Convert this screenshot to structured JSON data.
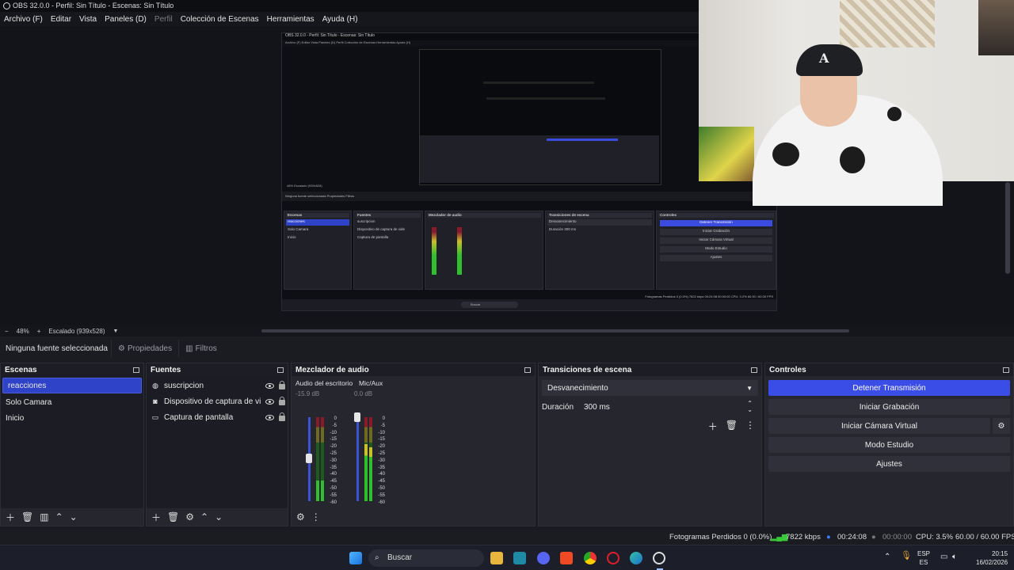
{
  "window": {
    "title": "OBS 32.0.0 - Perfil: Sin Título - Escenas: Sin Título"
  },
  "menu": [
    {
      "label": "Archivo (F)",
      "enabled": true
    },
    {
      "label": "Editar",
      "enabled": true
    },
    {
      "label": "Vista",
      "enabled": true
    },
    {
      "label": "Paneles (D)",
      "enabled": true
    },
    {
      "label": "Perfil",
      "enabled": false
    },
    {
      "label": "Colección de Escenas",
      "enabled": true
    },
    {
      "label": "Herramientas",
      "enabled": true
    },
    {
      "label": "Ayuda (H)",
      "enabled": true
    }
  ],
  "preview": {
    "zoom_minus": "−",
    "zoom": "48%",
    "zoom_plus": "+",
    "scale_mode": "Escalado (939x528)",
    "nested": {
      "title": "OBS 32.0.0 - Perfil: Sin Título - Escenas: Sin Título",
      "menu": "Archivo (F)   Editar   Vista   Paneles (D)   Perfil   Colección de Escenas   Herramientas   Ayuda (H)",
      "toolbar": "Ninguna fuente seleccionada     Propiedades     Filtros",
      "zoom_line": "48%    Escalado (939x528)",
      "scenes_title": "Escenas",
      "scenes": [
        "reacciones",
        "Solo Camara",
        "Inicio"
      ],
      "sources_title": "Fuentes",
      "sources": [
        "suscripcion",
        "Dispositivo de captura de vide",
        "Captura de pantalla"
      ],
      "mixer_title": "Mezclador de audio",
      "transitions_title": "Transiciones de escena",
      "transition": "Desvanecimiento",
      "duration": "Duración   300 ms",
      "controls_title": "Controles",
      "controls": [
        "Detener Transmisión",
        "Iniciar Grabación",
        "Iniciar Cámara Virtual",
        "Modo Estudio",
        "Ajustes"
      ],
      "status": "Fotogramas Perdidos 0 (0.0%)   7822 kbps   00:24:08   00:00:00   CPU: 3.2%   60.00 / 60.00 FPS",
      "search": "Buscar"
    }
  },
  "context_bar": {
    "no_selection": "Ninguna fuente seleccionada",
    "properties": "Propiedades",
    "filters": "Filtros"
  },
  "scenes": {
    "title": "Escenas",
    "items": [
      {
        "label": "reacciones",
        "selected": true
      },
      {
        "label": "Solo Camara",
        "selected": false
      },
      {
        "label": "Inicio",
        "selected": false
      }
    ]
  },
  "sources": {
    "title": "Fuentes",
    "items": [
      {
        "label": "suscripcion",
        "icon": "globe-icon"
      },
      {
        "label": "Dispositivo de captura de video",
        "icon": "camera-icon"
      },
      {
        "label": "Captura de pantalla",
        "icon": "monitor-icon"
      }
    ]
  },
  "mixer": {
    "title": "Mezclador de audio",
    "channels": [
      {
        "name": "Audio del escritorio",
        "db": "-15.9 dB"
      },
      {
        "name": "Mic/Aux",
        "db": "0.0 dB"
      }
    ],
    "scale": [
      "0",
      "-5",
      "-10",
      "-15",
      "-20",
      "-25",
      "-30",
      "-35",
      "-40",
      "-45",
      "-50",
      "-55",
      "-60"
    ]
  },
  "transitions": {
    "title": "Transiciones de escena",
    "selected": "Desvanecimiento",
    "duration_label": "Duración",
    "duration_value": "300 ms"
  },
  "controls": {
    "title": "Controles",
    "stop_stream": "Detener Transmisión",
    "start_recording": "Iniciar Grabación",
    "start_virtual_cam": "Iniciar Cámara Virtual",
    "studio_mode": "Modo Estudio",
    "settings": "Ajustes"
  },
  "status": {
    "dropped_frames": "Fotogramas Perdidos 0 (0.0%)",
    "bitrate": "7822 kbps",
    "stream_time": "00:24:08",
    "record_time": "00:00:00",
    "cpu": "CPU: 3.5%",
    "fps": "60.00 / 60.00 FPS"
  },
  "taskbar": {
    "search_placeholder": "Buscar",
    "lang_top": "ESP",
    "lang_bottom": "ES",
    "time": "20:15",
    "date": "16/02/2026"
  },
  "colors": {
    "accent": "#3a4de6",
    "selected_scene": "#2f43c8",
    "dock_bg": "#1c1d24",
    "meter_green": "#2fbf2f",
    "meter_yellow": "#c9c12a",
    "meter_red": "#8a1a2a"
  }
}
